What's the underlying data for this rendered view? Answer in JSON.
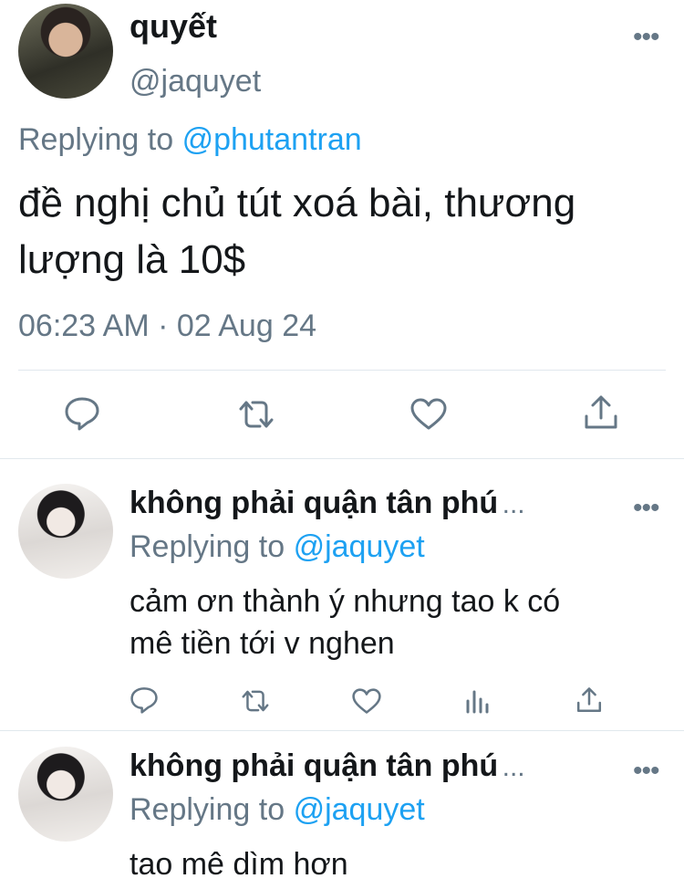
{
  "main_tweet": {
    "display_name": "quyết",
    "handle": "@jaquyet",
    "replying_prefix": "Replying to",
    "replying_mention": "@phutantran",
    "text_line1": "đề nghị chủ tút xoá bài, thương",
    "text_line2": "lượng là 10$",
    "timestamp": "06:23 AM · 02 Aug 24",
    "more_label": "•••"
  },
  "replies": [
    {
      "display_name": "không phải quận tân phú",
      "ellipsis": "...",
      "replying_prefix": "Replying to",
      "replying_mention": "@jaquyet",
      "text_line1": "cảm ơn thành ý nhưng tao k có",
      "text_line2": "mê tiền tới v nghen",
      "more_label": "•••"
    },
    {
      "display_name": "không phải quận tân phú",
      "ellipsis": "...",
      "replying_prefix": "Replying to",
      "replying_mention": "@jaquyet",
      "text_line1": "tao mê dìm hơn",
      "more_label": "•••"
    }
  ],
  "icons": {
    "reply": "reply-icon",
    "retweet": "retweet-icon",
    "like": "like-icon",
    "share": "share-icon",
    "analytics": "analytics-icon"
  },
  "colors": {
    "accent": "#1da1f2",
    "secondary_text": "#657786",
    "primary_text": "#14171a",
    "divider": "#e1e8ed"
  }
}
